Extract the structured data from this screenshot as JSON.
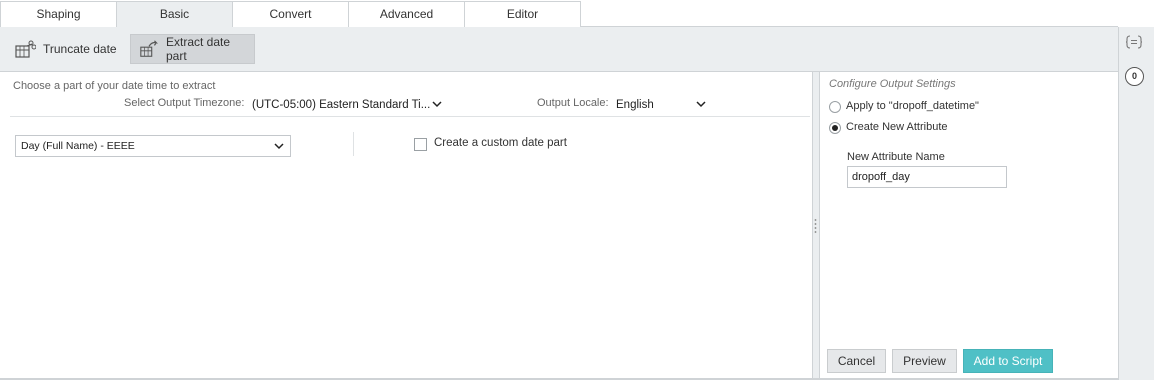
{
  "tabs": [
    {
      "label": "Shaping",
      "active": false
    },
    {
      "label": "Basic",
      "active": true
    },
    {
      "label": "Convert",
      "active": false
    },
    {
      "label": "Advanced",
      "active": false
    },
    {
      "label": "Editor",
      "active": false
    }
  ],
  "toolbar": {
    "truncate_label": "Truncate date",
    "extract_label": "Extract date part"
  },
  "sidebar": {
    "top_icon": "curly-braces-icon",
    "badge_count": "0"
  },
  "extract": {
    "instruction": "Choose a part of your date time to extract",
    "timezone_label": "Select Output Timezone:",
    "timezone_value": "(UTC-05:00) Eastern Standard Ti...",
    "locale_label": "Output Locale:",
    "locale_value": "English",
    "datepart_value": "Day (Full Name) - EEEE",
    "custom_label": "Create a custom date part",
    "custom_checked": false
  },
  "settings": {
    "title": "Configure Output Settings",
    "apply_label": "Apply to \"dropoff_datetime\"",
    "create_label": "Create New Attribute",
    "selected": "create",
    "new_attr_label": "New Attribute Name",
    "new_attr_value": "dropoff_day"
  },
  "actions": {
    "cancel": "Cancel",
    "preview": "Preview",
    "add": "Add to Script"
  },
  "colors": {
    "accent": "#4fc0c6",
    "panel_bg": "#ebeef0"
  }
}
